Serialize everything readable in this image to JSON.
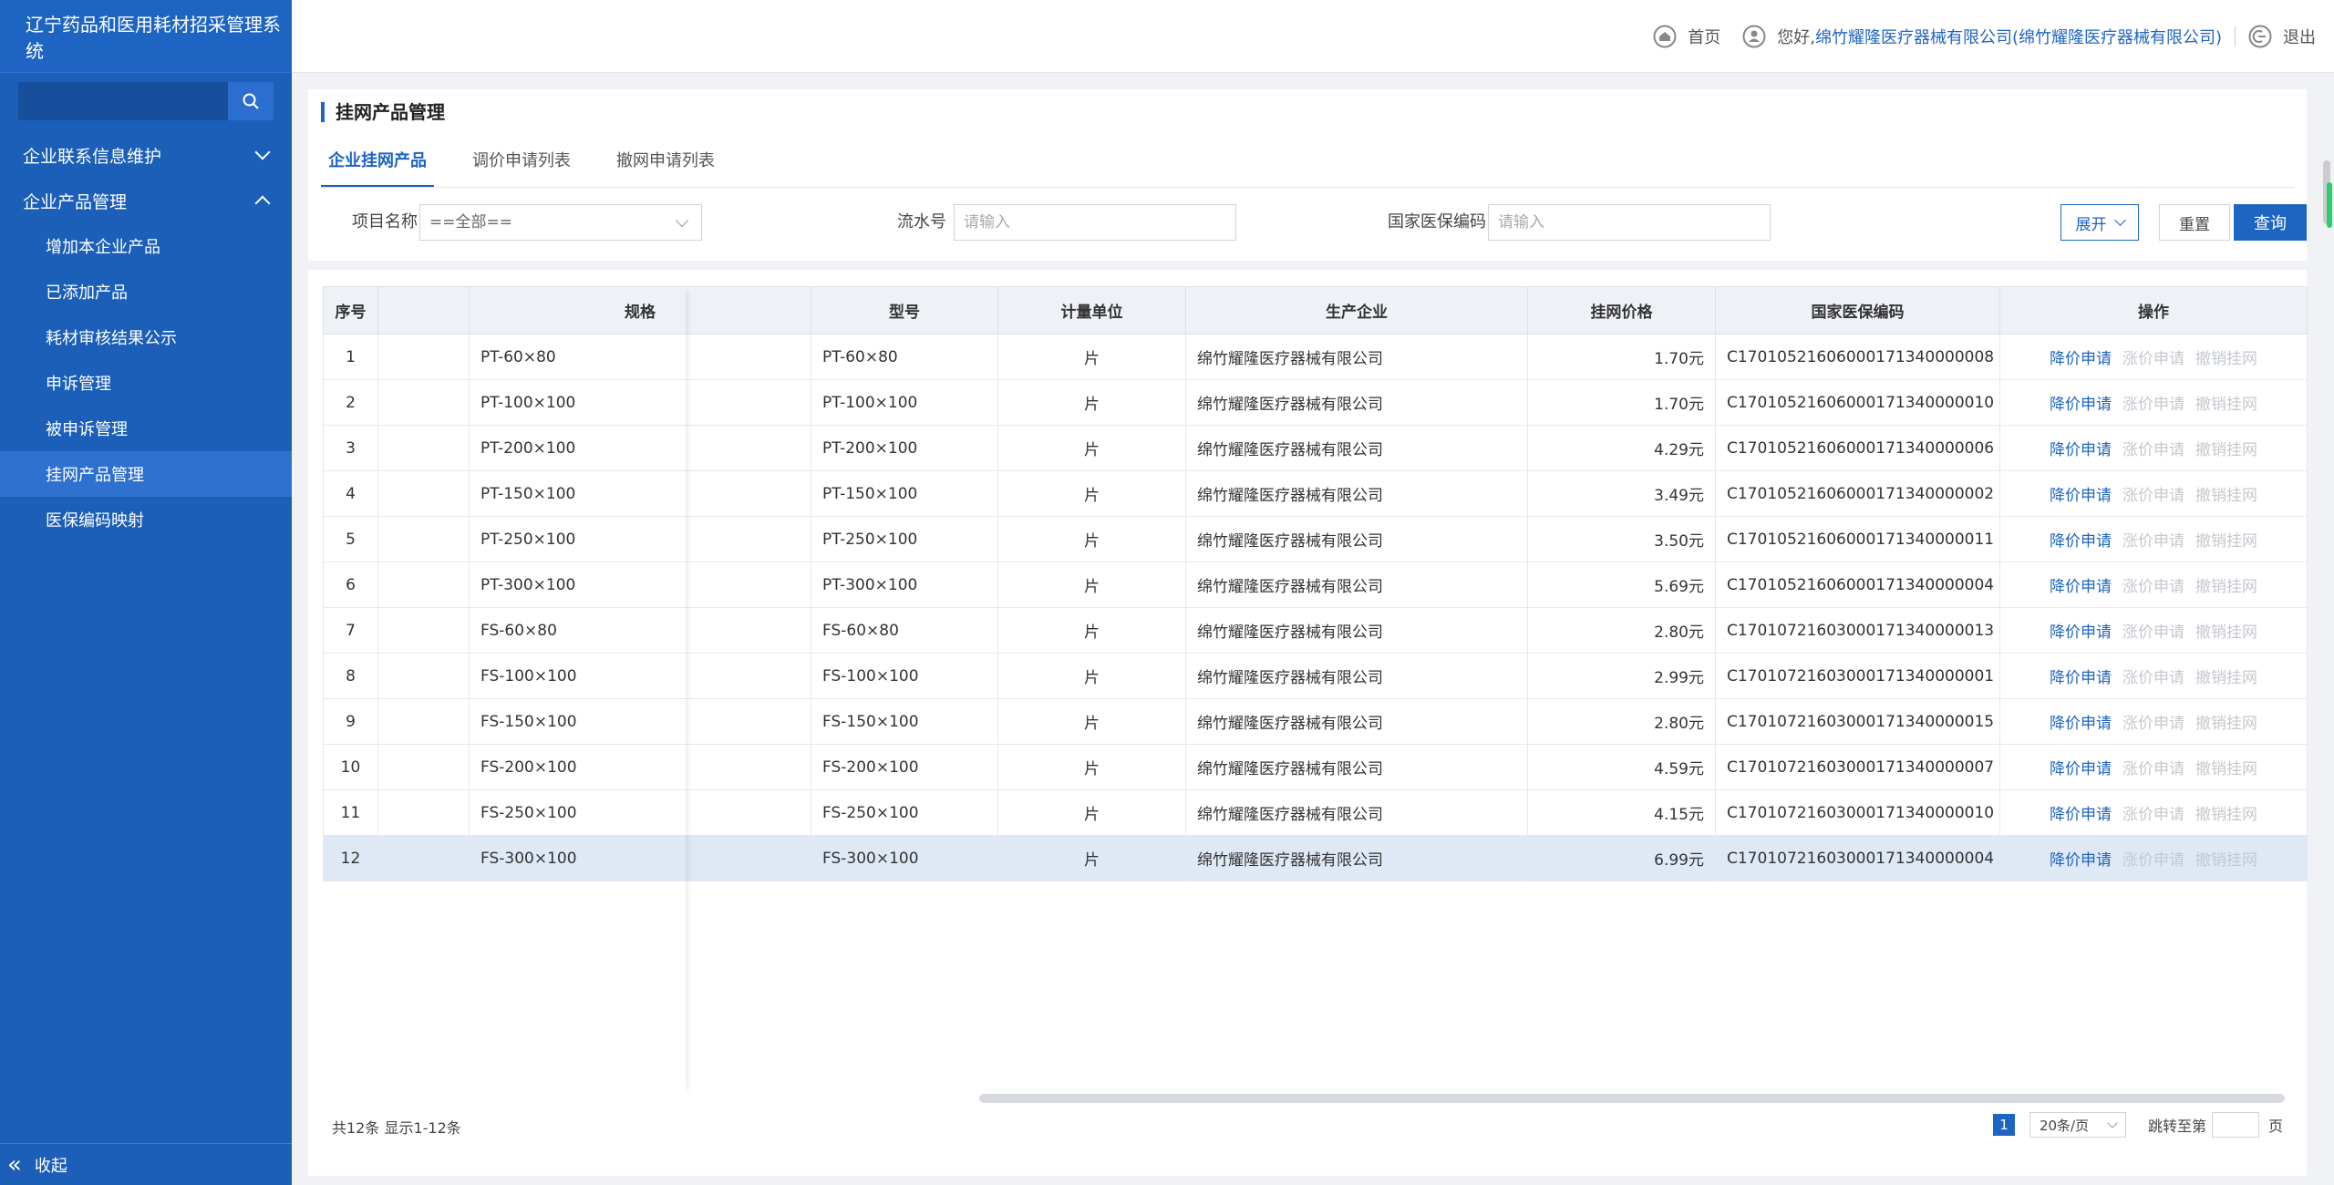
{
  "app": {
    "title": "辽宁药品和医用耗材招采管理系统"
  },
  "sidebar": {
    "search_placeholder": "",
    "groups": [
      {
        "label": "企业联系信息维护"
      },
      {
        "label": "企业产品管理"
      }
    ],
    "items": [
      {
        "label": "增加本企业产品"
      },
      {
        "label": "已添加产品"
      },
      {
        "label": "耗材审核结果公示"
      },
      {
        "label": "申诉管理"
      },
      {
        "label": "被申诉管理"
      },
      {
        "label": "挂网产品管理"
      },
      {
        "label": "医保编码映射"
      }
    ],
    "collapse_label": "收起"
  },
  "header": {
    "home_label": "首页",
    "greeting": "您好,",
    "user": "绵竹耀隆医疗器械有限公司(绵竹耀隆医疗器械有限公司)",
    "logout_label": "退出"
  },
  "page": {
    "title": "挂网产品管理",
    "tabs": [
      "企业挂网产品",
      "调价申请列表",
      "撤网申请列表"
    ]
  },
  "filters": {
    "project_label": "项目名称",
    "project_value": "==全部==",
    "serial_label": "流水号",
    "serial_placeholder": "请输入",
    "code_label": "国家医保编码",
    "code_placeholder": "请输入",
    "expand_label": "展开",
    "reset_label": "重置",
    "query_label": "查询"
  },
  "table": {
    "headers": [
      "序号",
      "",
      "规格",
      "型号",
      "计量单位",
      "生产企业",
      "挂网价格",
      "国家医保编码",
      "操作"
    ],
    "rows": [
      {
        "no": "1",
        "spec": "PT-60×80",
        "model": "PT-60×80",
        "unit": "片",
        "maker": "绵竹耀隆医疗器械有限公司",
        "price": "1.70元",
        "code": "C17010521606000171340000008"
      },
      {
        "no": "2",
        "spec": "PT-100×100",
        "model": "PT-100×100",
        "unit": "片",
        "maker": "绵竹耀隆医疗器械有限公司",
        "price": "1.70元",
        "code": "C17010521606000171340000010"
      },
      {
        "no": "3",
        "spec": "PT-200×100",
        "model": "PT-200×100",
        "unit": "片",
        "maker": "绵竹耀隆医疗器械有限公司",
        "price": "4.29元",
        "code": "C17010521606000171340000006"
      },
      {
        "no": "4",
        "spec": "PT-150×100",
        "model": "PT-150×100",
        "unit": "片",
        "maker": "绵竹耀隆医疗器械有限公司",
        "price": "3.49元",
        "code": "C17010521606000171340000002"
      },
      {
        "no": "5",
        "spec": "PT-250×100",
        "model": "PT-250×100",
        "unit": "片",
        "maker": "绵竹耀隆医疗器械有限公司",
        "price": "3.50元",
        "code": "C17010521606000171340000011"
      },
      {
        "no": "6",
        "spec": "PT-300×100",
        "model": "PT-300×100",
        "unit": "片",
        "maker": "绵竹耀隆医疗器械有限公司",
        "price": "5.69元",
        "code": "C17010521606000171340000004"
      },
      {
        "no": "7",
        "spec": "FS-60×80",
        "model": "FS-60×80",
        "unit": "片",
        "maker": "绵竹耀隆医疗器械有限公司",
        "price": "2.80元",
        "code": "C17010721603000171340000013"
      },
      {
        "no": "8",
        "spec": "FS-100×100",
        "model": "FS-100×100",
        "unit": "片",
        "maker": "绵竹耀隆医疗器械有限公司",
        "price": "2.99元",
        "code": "C17010721603000171340000001"
      },
      {
        "no": "9",
        "spec": "FS-150×100",
        "model": "FS-150×100",
        "unit": "片",
        "maker": "绵竹耀隆医疗器械有限公司",
        "price": "2.80元",
        "code": "C17010721603000171340000015"
      },
      {
        "no": "10",
        "spec": "FS-200×100",
        "model": "FS-200×100",
        "unit": "片",
        "maker": "绵竹耀隆医疗器械有限公司",
        "price": "4.59元",
        "code": "C17010721603000171340000007"
      },
      {
        "no": "11",
        "spec": "FS-250×100",
        "model": "FS-250×100",
        "unit": "片",
        "maker": "绵竹耀隆医疗器械有限公司",
        "price": "4.15元",
        "code": "C17010721603000171340000010"
      },
      {
        "no": "12",
        "spec": "FS-300×100",
        "model": "FS-300×100",
        "unit": "片",
        "maker": "绵竹耀隆医疗器械有限公司",
        "price": "6.99元",
        "code": "C17010721603000171340000004"
      }
    ],
    "ops": {
      "lower": "降价申请",
      "raise": "涨价申请",
      "withdraw": "撤销挂网"
    }
  },
  "pagination": {
    "summary": "共12条 显示1-12条",
    "current_page": "1",
    "page_size": "20条/页",
    "jump_label": "跳转至第",
    "page_suffix": "页"
  },
  "colors": {
    "primary": "#1e64c2",
    "sidebar": "#1b5fb8",
    "disabled": "#c4c8ce"
  }
}
